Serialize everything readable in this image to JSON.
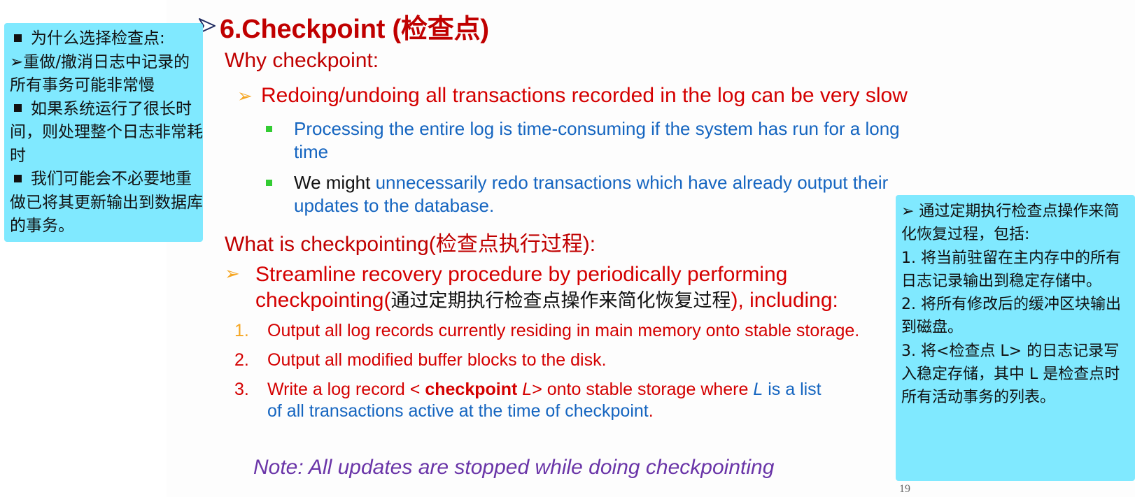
{
  "title": "6.Checkpoint (检查点)",
  "section1": {
    "heading": "Why checkpoint:",
    "point": "Redoing/undoing all transactions recorded in the log can be very slow",
    "sub1": "Processing the entire log is time-consuming if the system has run for a long time",
    "sub2_lead": "We might",
    "sub2_rest": " unnecessarily redo transactions which have already output their updates to the database."
  },
  "section2": {
    "heading": "What is checkpointing(检查点执行过程):",
    "point_a": "Streamline recovery procedure by periodically performing checkpointing(",
    "point_b": "通过定期执行检查点操作来简化恢复过程",
    "point_c": "), including:",
    "items": [
      {
        "num": "1.",
        "text": "Output all log records currently residing in main memory onto stable  storage."
      },
      {
        "num": "2.",
        "text": "Output all modified buffer blocks to the disk."
      }
    ],
    "item3": {
      "num": "3.",
      "p1": "Write a log record < ",
      "p2": "checkpoint",
      "p3": " L",
      "p4": "> onto stable storage where ",
      "p5": "L",
      "p6": " is a list of all transactions active at the time of checkpoint",
      "p7": "."
    }
  },
  "note": "Note:   All updates are stopped while doing checkpointing",
  "page_number": "19",
  "left_note": {
    "line1": "为什么选择检查点:",
    "line2": "➢重做/撤消日志中记录的所有事务可能非常慢",
    "line3": "如果系统运行了很长时间，则处理整个日志非常耗时",
    "line4": "我们可能会不必要地重做已将其更新输出到数据库的事务。"
  },
  "right_note": {
    "line1": "➢ 通过定期执行检查点操作来简化恢复过程，包括:",
    "line2": "1. 将当前驻留在主内存中的所有日志记录输出到稳定存储中。",
    "line3": "2. 将所有修改后的缓冲区块输出到磁盘。",
    "line4": "3. 将<检查点 L> 的日志记录写入稳定存储，其中 L 是检查点时所有活动事务的列表。"
  },
  "colors": {
    "title_red": "#c00000",
    "body_red": "#d40000",
    "blue": "#1565c0",
    "note_purple": "#6a35a8",
    "arrow_orange": "#f5a623",
    "bullet_green": "#33cc33",
    "note_box_cyan": "#80e9ff"
  },
  "icons": {
    "title_bullet": "hollow-arrowhead-icon",
    "level1_bullet": "arrowhead-icon",
    "level2_bullet": "green-square-icon"
  }
}
